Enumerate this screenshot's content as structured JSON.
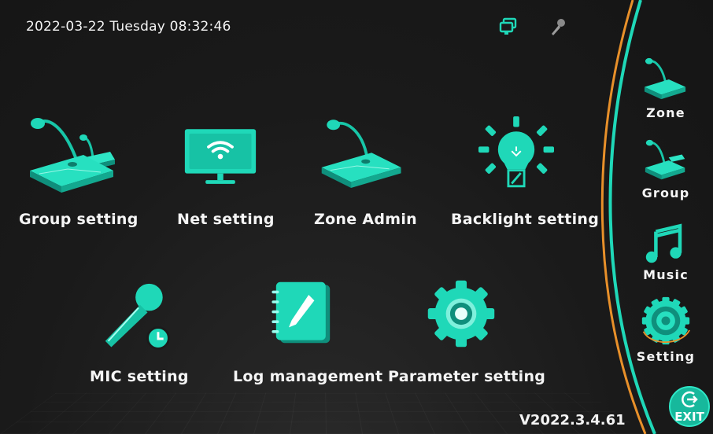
{
  "status_bar": {
    "datetime": "2022-03-22 Tuesday 08:32:46",
    "icons": [
      "monitor-icon",
      "microphone-icon"
    ]
  },
  "main": {
    "tiles": [
      {
        "label": "Group setting",
        "icon": "group-paging-console-icon"
      },
      {
        "label": "Net setting",
        "icon": "wifi-monitor-icon"
      },
      {
        "label": "Zone Admin",
        "icon": "paging-console-icon"
      },
      {
        "label": "Backlight setting",
        "icon": "light-bulb-icon"
      },
      {
        "label": "MIC setting",
        "icon": "microphone-clock-icon"
      },
      {
        "label": "Log management",
        "icon": "notebook-pen-icon"
      },
      {
        "label": "Parameter setting",
        "icon": "gear-icon"
      }
    ]
  },
  "sidebar": {
    "items": [
      {
        "label": "Zone",
        "icon": "paging-console-icon"
      },
      {
        "label": "Group",
        "icon": "group-paging-console-icon"
      },
      {
        "label": "Music",
        "icon": "music-note-icon"
      },
      {
        "label": "Setting",
        "icon": "gear-icon",
        "active": true
      }
    ],
    "exit_label": "EXIT"
  },
  "footer": {
    "version": "V2022.3.4.61"
  },
  "colors": {
    "accent": "#1fd8b8",
    "accent_dark": "#0f8f7c",
    "orange": "#e8902a",
    "background": "#1b1b1b"
  }
}
